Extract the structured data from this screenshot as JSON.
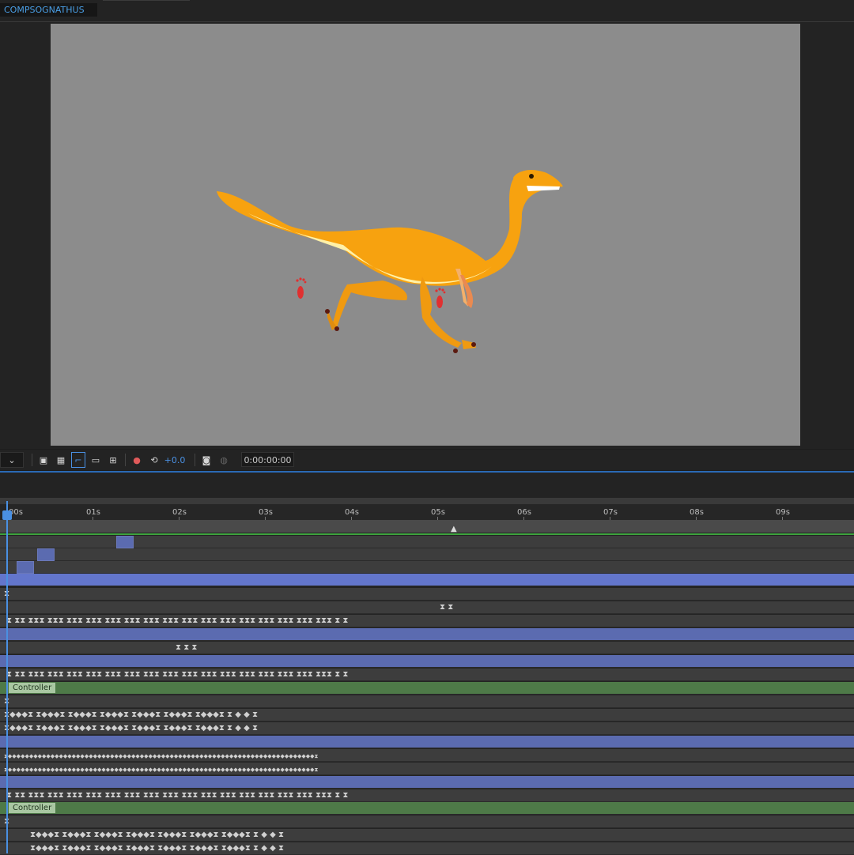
{
  "composition": {
    "name": "COMPSOGNATHUS"
  },
  "viewer": {
    "background_color": "#8c8c8c",
    "subject": "orange compsognathus dinosaur running with red footprints"
  },
  "toolbar": {
    "exposure_value": "+0.0",
    "timecode": "0:00:00:00",
    "icons": [
      "dropdown-chevron-icon",
      "snapshot-preview-icon",
      "transparency-grid-icon",
      "mask-path-icon",
      "safe-margins-icon",
      "grid-guides-icon",
      "color-channels-icon",
      "reset-exposure-icon",
      "camera-snapshot-icon",
      "show-snapshot-icon"
    ]
  },
  "timeline": {
    "ruler_ticks": [
      "00s",
      "01s",
      "02s",
      "03s",
      "04s",
      "05s",
      "06s",
      "07s",
      "08s",
      "09s"
    ],
    "layer_labels": [
      "Controller",
      "Controller"
    ],
    "keyframe_row_a": "⧗ ⧗⧗  ⧗⧗⧗  ⧗⧗⧗  ⧗⧗⧗  ⧗⧗⧗  ⧗⧗⧗  ⧗⧗⧗  ⧗⧗⧗  ⧗⧗⧗  ⧗⧗⧗  ⧗⧗⧗  ⧗⧗⧗  ⧗⧗⧗  ⧗⧗⧗  ⧗⧗⧗  ⧗⧗⧗  ⧗⧗⧗  ⧗ ⧗",
    "keyframe_row_b": "⧗◆◆◆⧗    ⧗◆◆◆⧗    ⧗◆◆◆⧗    ⧗◆◆◆⧗    ⧗◆◆◆⧗    ⧗◆◆◆⧗    ⧗◆◆◆⧗    ⧗ ◆ ◆ ⧗",
    "keyframe_row_c": "⧗◆◆◆◆◆◆◆◆◆◆◆◆◆◆◆◆◆◆◆◆◆◆◆◆◆◆◆◆◆◆◆◆◆◆◆◆◆◆◆◆◆◆◆◆◆◆◆◆◆◆◆◆◆◆◆◆◆◆◆◆◆◆◆◆◆◆◆◆◆◆◆◆⧗",
    "keyframe_row_d": "⧗ ⧗ ⧗",
    "keyframe_row_e": "⧗ ⧗",
    "playhead_time": "00s",
    "colors": {
      "purple": "#5b6bb0",
      "green": "#4e7a48",
      "playhead": "#4a90e2",
      "work_area_line": "#3ea33e"
    }
  }
}
